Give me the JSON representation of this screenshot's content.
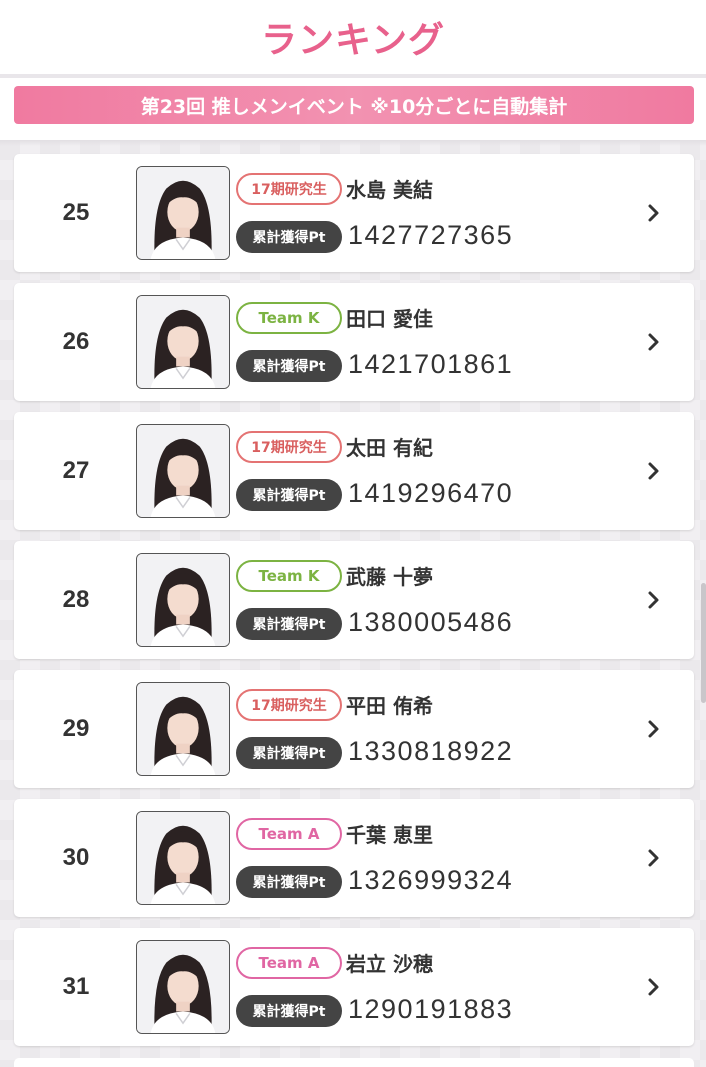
{
  "header": {
    "title": "ランキング"
  },
  "event": {
    "label": "第23回 推しメンイベント ※10分ごとに自動集計"
  },
  "pt_label": "累計獲得Pt",
  "colors": {
    "accent_pink": "#e8618c",
    "banner_pink": "#f07aa0",
    "team_k": "#7cb342",
    "team_a": "#e066a3",
    "trainee": "#d95f5f",
    "pt_badge": "#444444"
  },
  "rankings": [
    {
      "rank": "25",
      "team": "17期研究生",
      "team_type": "r",
      "name": "水島 美結",
      "points": "1427727365"
    },
    {
      "rank": "26",
      "team": "Team K",
      "team_type": "k",
      "name": "田口 愛佳",
      "points": "1421701861"
    },
    {
      "rank": "27",
      "team": "17期研究生",
      "team_type": "r",
      "name": "太田 有紀",
      "points": "1419296470"
    },
    {
      "rank": "28",
      "team": "Team K",
      "team_type": "k",
      "name": "武藤 十夢",
      "points": "1380005486"
    },
    {
      "rank": "29",
      "team": "17期研究生",
      "team_type": "r",
      "name": "平田 侑希",
      "points": "1330818922"
    },
    {
      "rank": "30",
      "team": "Team A",
      "team_type": "a",
      "name": "千葉 恵里",
      "points": "1326999324"
    },
    {
      "rank": "31",
      "team": "Team A",
      "team_type": "a",
      "name": "岩立 沙穂",
      "points": "1290191883"
    }
  ],
  "icons": {
    "row_action": "chevron-right-icon",
    "photo": "member-photo"
  }
}
